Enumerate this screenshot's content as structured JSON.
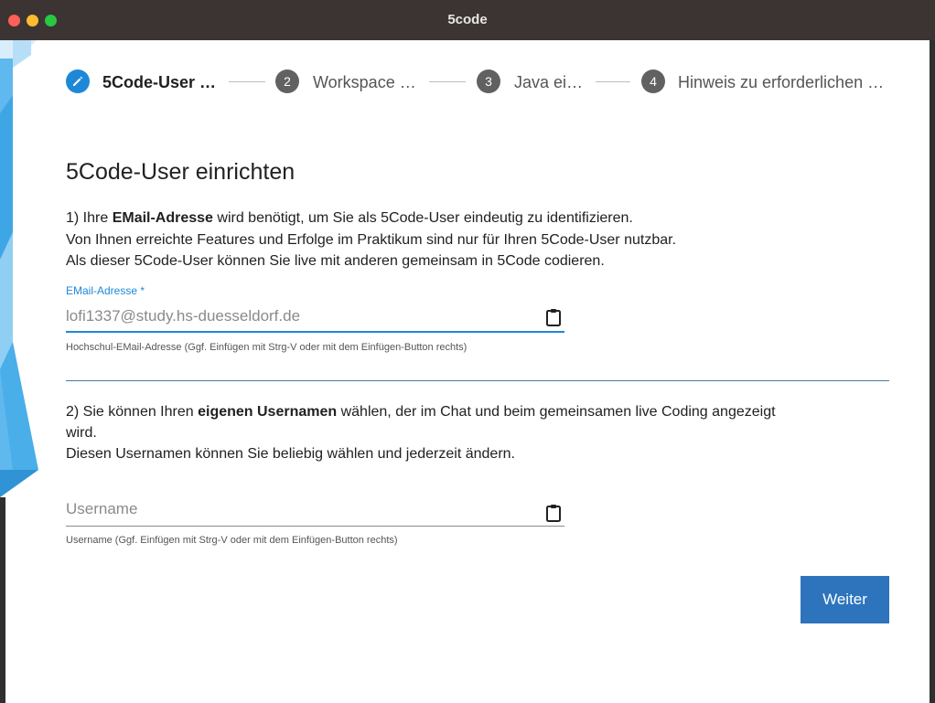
{
  "window": {
    "title": "5code"
  },
  "stepper": {
    "steps": [
      {
        "number": "",
        "label": "5Code-User …",
        "active": true
      },
      {
        "number": "2",
        "label": "Workspace …"
      },
      {
        "number": "3",
        "label": "Java ei…"
      },
      {
        "number": "4",
        "label": "Hinweis zu erforderlichen …"
      }
    ]
  },
  "page": {
    "title": "5Code-User einrichten",
    "section1": {
      "line1_pre": "1) Ihre ",
      "line1_bold": "EMail-Adresse",
      "line1_post": " wird benötigt, um Sie als 5Code-User eindeutig zu identifizieren.",
      "line2": "Von Ihnen erreichte Features und Erfolge im Praktikum sind nur für Ihren 5Code-User nutzbar.",
      "line3": "Als dieser 5Code-User können Sie live mit anderen gemeinsam in 5Code codieren."
    },
    "email_field": {
      "label": "EMail-Adresse *",
      "value": "lofi1337@study.hs-duesseldorf.de",
      "helper": "Hochschul-EMail-Adresse (Ggf. Einfügen mit Strg-V oder mit dem Einfügen-Button rechts)"
    },
    "section2": {
      "line1_pre": "2) Sie können Ihren ",
      "line1_bold": "eigenen Usernamen",
      "line1_post": " wählen, der im Chat und beim gemeinsamen live Coding angezeigt",
      "line2": "wird.",
      "line3": "Diesen Usernamen können Sie beliebig wählen und jederzeit ändern."
    },
    "username_field": {
      "placeholder": "Username",
      "value": "",
      "helper": "Username (Ggf. Einfügen mit Strg-V oder mit dem Einfügen-Button rechts)"
    },
    "next_button": "Weiter"
  },
  "colors": {
    "accent": "#1e88d8",
    "button": "#2d74bd",
    "titlebar": "#3c3432"
  },
  "icons": {
    "step1": "pencil-icon",
    "paste": "clipboard-icon"
  }
}
